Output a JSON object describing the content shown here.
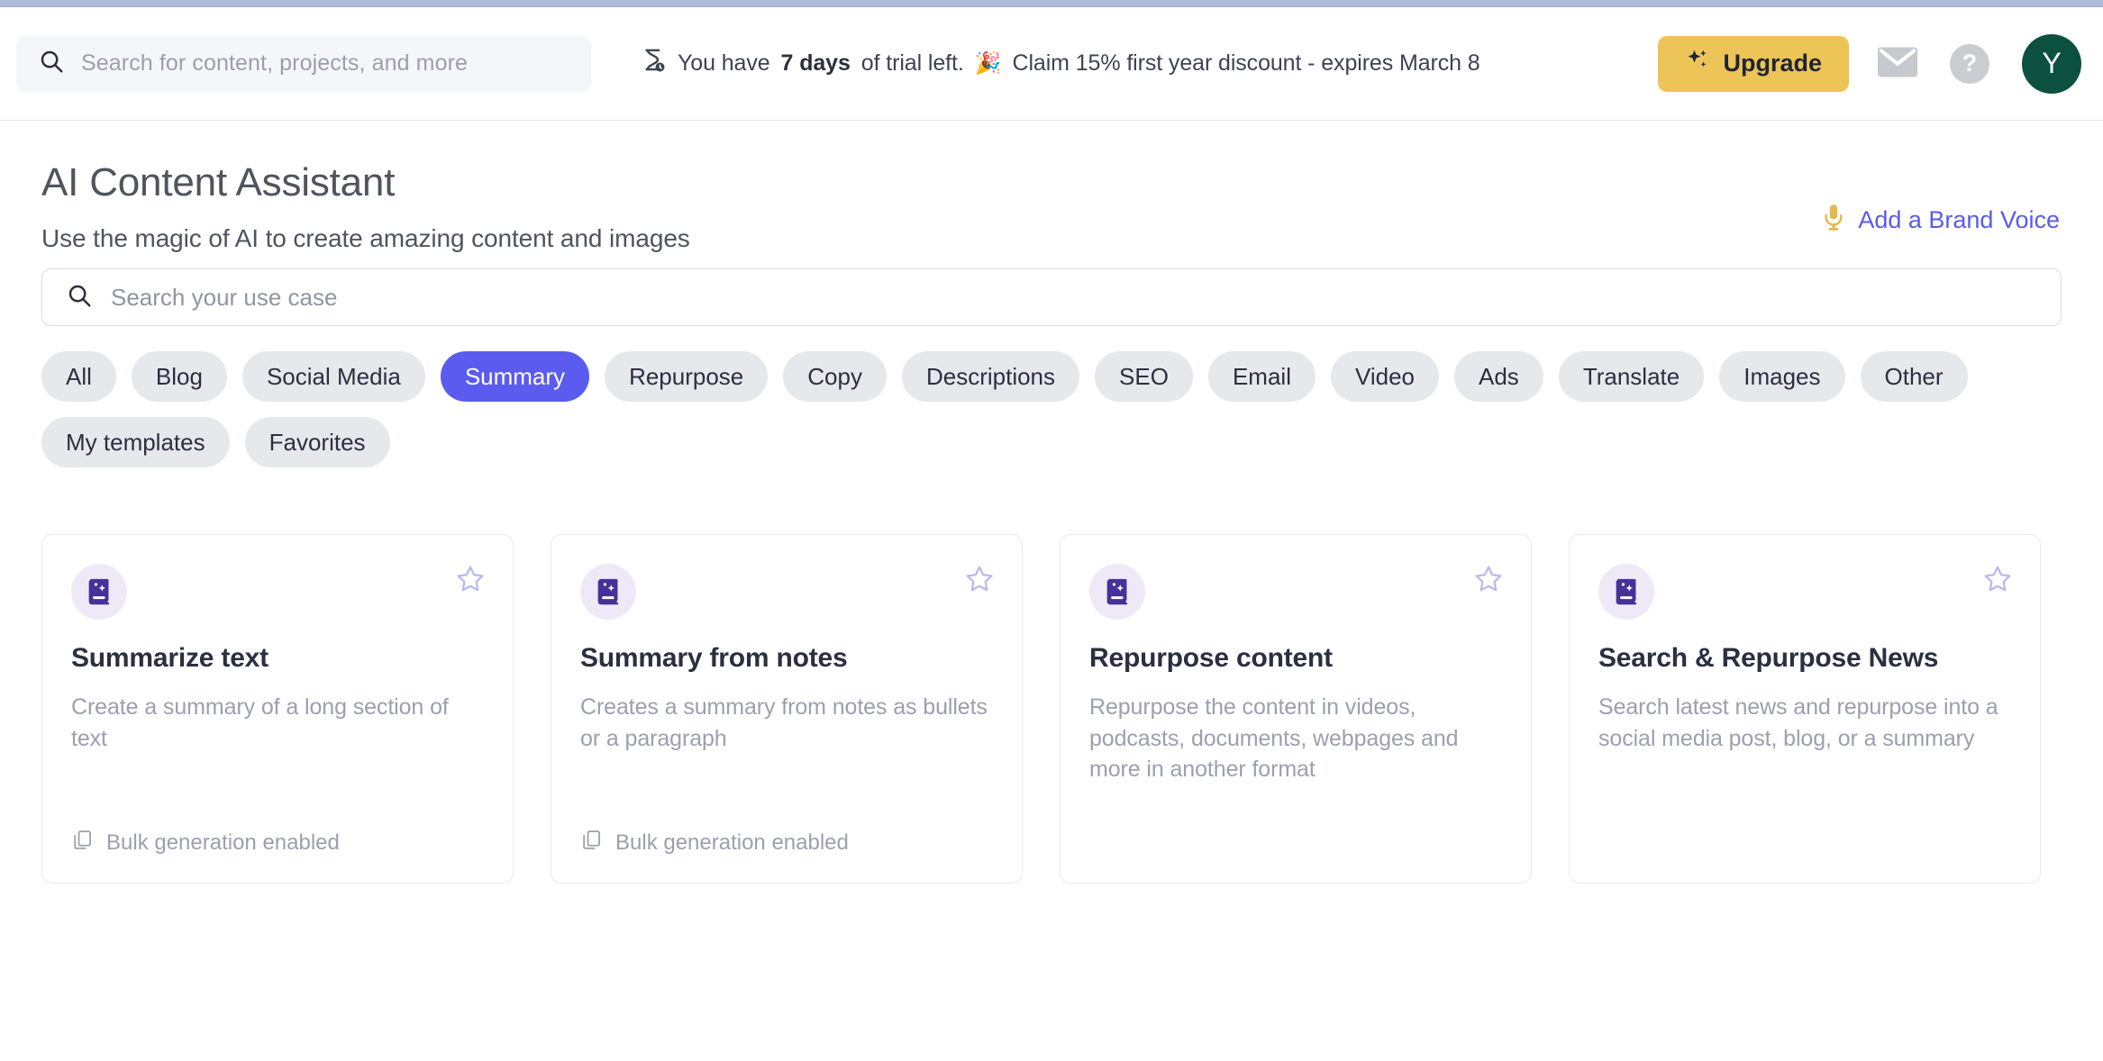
{
  "topbar": {
    "global_search_placeholder": "Search for content, projects, and more",
    "search_icon": "search-icon",
    "trial": {
      "hourglass_icon": "hourglass-clock-icon",
      "prefix": "You have ",
      "days": "7 days",
      "middle": " of trial left. ",
      "party_emoji": "🎉",
      "offer": " Claim 15% first year discount - expires March 8"
    },
    "upgrade_label": "Upgrade",
    "upgrade_icon": "sparkles-icon",
    "upgrade_bg": "#edc457",
    "mail_icon": "mail-icon",
    "help_icon": "help-circle-icon",
    "help_glyph": "?",
    "avatar_initial": "Y",
    "avatar_bg": "#0c513f"
  },
  "page": {
    "title": "AI Content Assistant",
    "subtitle": "Use the magic of AI to create amazing content and images",
    "brand_voice_label": "Add a Brand Voice",
    "brand_voice_icon": "microphone-icon",
    "brand_voice_color": "#5b5be8"
  },
  "usecase_search": {
    "placeholder": "Search your use case",
    "icon": "search-icon",
    "value": ""
  },
  "filters": {
    "active": "Summary",
    "active_bg": "#5b5bf0",
    "chips": [
      {
        "label": "All",
        "active": false
      },
      {
        "label": "Blog",
        "active": false
      },
      {
        "label": "Social Media",
        "active": false
      },
      {
        "label": "Summary",
        "active": true
      },
      {
        "label": "Repurpose",
        "active": false
      },
      {
        "label": "Copy",
        "active": false
      },
      {
        "label": "Descriptions",
        "active": false
      },
      {
        "label": "SEO",
        "active": false
      },
      {
        "label": "Email",
        "active": false
      },
      {
        "label": "Video",
        "active": false
      },
      {
        "label": "Ads",
        "active": false
      },
      {
        "label": "Translate",
        "active": false
      },
      {
        "label": "Images",
        "active": false
      },
      {
        "label": "Other",
        "active": false
      },
      {
        "label": "My templates",
        "active": false
      },
      {
        "label": "Favorites",
        "active": false
      }
    ]
  },
  "cards": [
    {
      "title": "Summarize text",
      "description": "Create a summary of a long section of text",
      "icon": "magic-book-icon",
      "star_icon": "star-outline-icon",
      "bulk_label": "Bulk generation enabled",
      "bulk_icon": "copy-icon",
      "bulk_enabled": true
    },
    {
      "title": "Summary from notes",
      "description": "Creates a summary from notes as bullets or a paragraph",
      "icon": "magic-book-icon",
      "star_icon": "star-outline-icon",
      "bulk_label": "Bulk generation enabled",
      "bulk_icon": "copy-icon",
      "bulk_enabled": true
    },
    {
      "title": "Repurpose content",
      "description": "Repurpose the content in videos, podcasts, documents, webpages and more in another format",
      "icon": "magic-book-icon",
      "star_icon": "star-outline-icon",
      "bulk_label": "",
      "bulk_icon": "copy-icon",
      "bulk_enabled": false
    },
    {
      "title": "Search & Repurpose News",
      "description": "Search latest news and repurpose into a social media post, blog, or a summary",
      "icon": "magic-book-icon",
      "star_icon": "star-outline-icon",
      "bulk_label": "",
      "bulk_icon": "copy-icon",
      "bulk_enabled": false
    }
  ]
}
